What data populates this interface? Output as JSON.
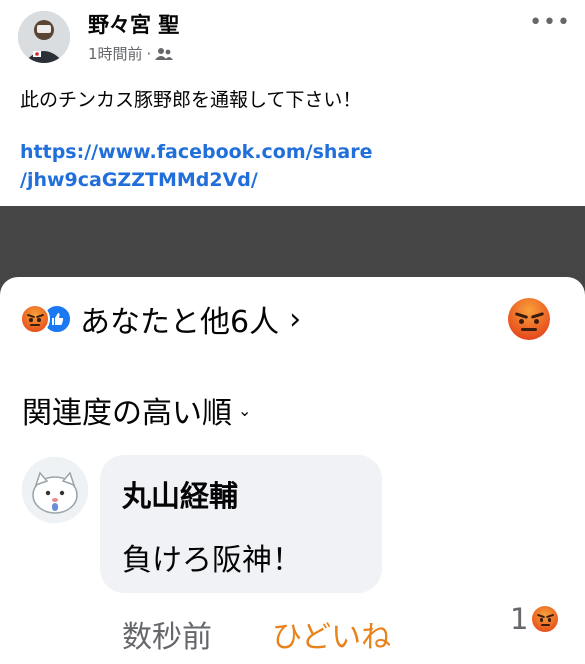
{
  "post": {
    "author": "野々宮 聖",
    "time": "1時間前",
    "separator": "·",
    "audience_icon": "friends-icon",
    "more_icon": "more-icon",
    "text": "此のチンカス豚野郎を通報して下さい！",
    "link": "https://www.facebook.com/share/jhw9caGZZTMMd2Vd/"
  },
  "reactions": {
    "summary": "あなたと他6人",
    "chevron": "›",
    "icons": [
      "angry-icon",
      "like-icon"
    ]
  },
  "sort": {
    "label": "関連度の高い順",
    "chevron": "⌄"
  },
  "comment": {
    "author": "丸山経輔",
    "text": "負けろ阪神！",
    "time": "数秒前",
    "reaction_label": "ひどいね",
    "reaction_count": "1"
  },
  "colors": {
    "link": "#216fdb",
    "angry_orange": "#e8821a",
    "overlay": "#454545"
  }
}
